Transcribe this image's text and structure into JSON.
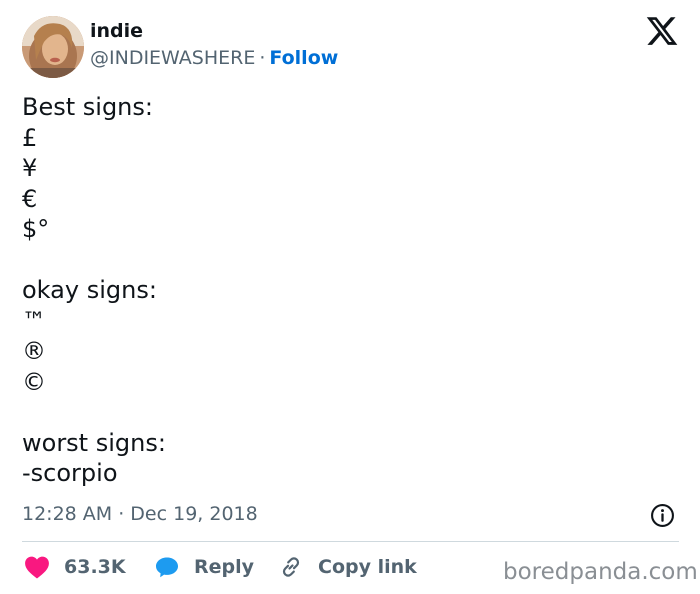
{
  "author": {
    "display_name": "indie",
    "handle": "@INDIEWASHERE",
    "separator": "·",
    "follow_label": "Follow"
  },
  "tweet": {
    "text": "Best signs:\n£\n¥\n€\n$°\n\nokay signs:\n™\n®\n©\n\nworst signs:\n-scorpio",
    "timestamp": "12:28 AM · Dec 19, 2018"
  },
  "actions": {
    "likes_count": "63.3K",
    "reply_label": "Reply",
    "copy_label": "Copy link"
  },
  "watermark": "boredpanda.com",
  "icons": {
    "brand": "x-logo-icon",
    "info": "info-icon",
    "like": "heart-icon",
    "reply": "speech-bubble-icon",
    "copy": "link-icon"
  },
  "colors": {
    "text": "#0f1419",
    "muted": "#536471",
    "follow": "#006fd6",
    "like": "#f91880",
    "reply": "#1d9bf0",
    "divider": "#cfd9de",
    "watermark": "#8a8f94"
  }
}
